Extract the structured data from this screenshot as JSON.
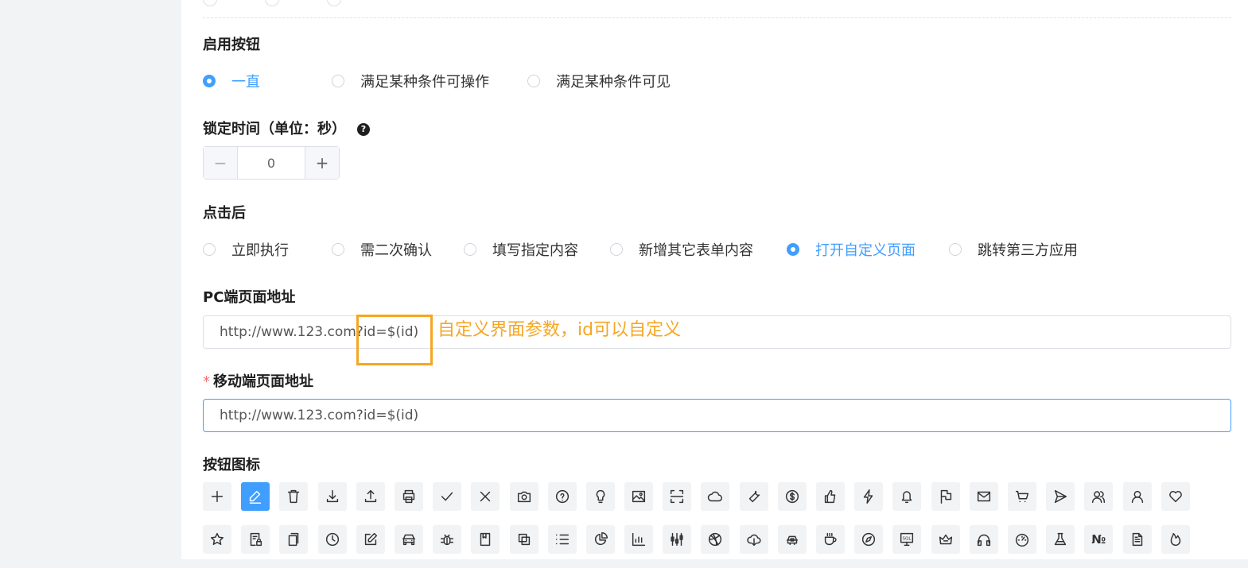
{
  "enable": {
    "label": "启用按钮",
    "options": [
      {
        "label": "一直",
        "checked": true
      },
      {
        "label": "满足某种条件可操作",
        "checked": false
      },
      {
        "label": "满足某种条件可见",
        "checked": false
      }
    ]
  },
  "lock": {
    "label": "锁定时间（单位：秒）",
    "help": "?",
    "minus": "−",
    "value": "0",
    "plus": "+"
  },
  "after_click": {
    "label": "点击后",
    "options": [
      {
        "label": "立即执行",
        "checked": false
      },
      {
        "label": "需二次确认",
        "checked": false
      },
      {
        "label": "填写指定内容",
        "checked": false
      },
      {
        "label": "新增其它表单内容",
        "checked": false
      },
      {
        "label": "打开自定义页面",
        "checked": true
      },
      {
        "label": "跳转第三方应用",
        "checked": false
      }
    ]
  },
  "pc_url": {
    "label": "PC端页面地址",
    "value": "http://www.123.com?id=$(id)"
  },
  "annotation": "自定义界面参数，id可以自定义",
  "mobile_url": {
    "required_mark": "*",
    "label": "移动端页面地址",
    "value": "http://www.123.com?id=$(id)"
  },
  "icons": {
    "label": "按钮图标",
    "accent": "#409eff",
    "row1": [
      "plus-icon",
      "edit-icon",
      "delete-icon",
      "download-icon",
      "upload-icon",
      "printer-icon",
      "check-icon",
      "close-icon",
      "camera-icon",
      "question-icon",
      "bulb-icon",
      "picture-icon",
      "scan-icon",
      "cloud-icon",
      "wrench-icon",
      "dollar-icon",
      "like-icon",
      "thunder-icon",
      "bell-icon",
      "flag-icon",
      "mail-icon",
      "cart-icon",
      "send-icon",
      "team-icon",
      "user-icon",
      "heart-icon"
    ],
    "row2": [
      "star-icon",
      "document-lock-icon",
      "copy-icon",
      "clock-icon",
      "edit-square-icon",
      "car-icon",
      "bug-icon",
      "book-icon",
      "block-icon",
      "list-icon",
      "pie-chart-icon",
      "bar-chart-icon",
      "sliders-icon",
      "dribbble-icon",
      "cloud-download-icon",
      "car-top-icon",
      "coffee-icon",
      "compass-icon",
      "sql-monitor-icon",
      "crown-icon",
      "headphones-icon",
      "dashboard-icon",
      "flask-icon",
      "number-icon",
      "file-text-icon",
      "fire-icon"
    ],
    "number_glyph": "№",
    "sql_glyph": "SQL"
  }
}
